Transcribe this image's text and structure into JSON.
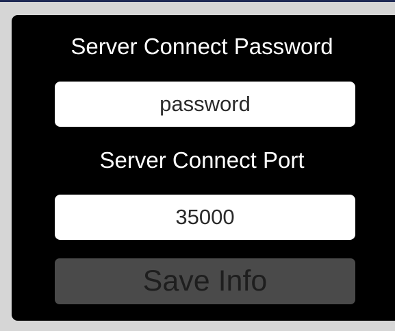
{
  "form": {
    "password_label": "Server Connect Password",
    "password_value": "password",
    "port_label": "Server Connect Port",
    "port_value": "35000",
    "save_label": "Save Info"
  },
  "colors": {
    "background": "#d6d6d6",
    "panel": "#000000",
    "field": "#ffffff",
    "button": "#4a4a4a",
    "button_text": "#1e1e1e",
    "label_text": "#ffffff",
    "top_line": "#1f2a55"
  }
}
